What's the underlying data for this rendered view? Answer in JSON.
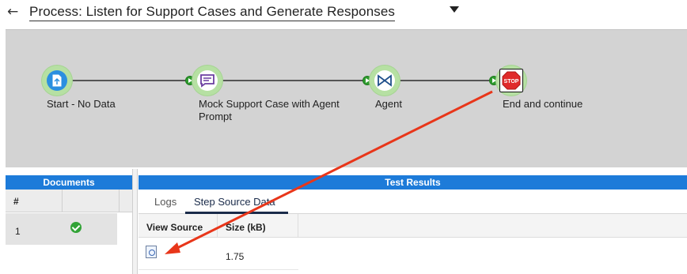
{
  "header": {
    "back_icon": "back-arrow-icon",
    "title": "Process: Listen for Support Cases and Generate Responses",
    "dropdown_icon": "caret-down-icon"
  },
  "flow": {
    "nodes": [
      {
        "label": "Start - No Data",
        "icon": "start-document-icon"
      },
      {
        "label": "Mock Support Case with Agent Prompt",
        "icon": "message-icon"
      },
      {
        "label": "Agent",
        "icon": "agent-icon"
      },
      {
        "label": "End and continue",
        "icon": "stop-sign-icon",
        "stop_text": "STOP"
      }
    ]
  },
  "documents": {
    "title": "Documents",
    "columns": [
      "#",
      ""
    ],
    "rows": [
      {
        "num": "1",
        "status": "success-check-icon"
      }
    ]
  },
  "test_results": {
    "title": "Test Results",
    "tabs": [
      "Logs",
      "Step Source Data"
    ],
    "active_tab": "Step Source Data",
    "table": {
      "columns": [
        "View Source",
        "Size (kB)"
      ],
      "rows": [
        {
          "view_source": "view-source-icon",
          "size": "1.75"
        }
      ]
    }
  },
  "colors": {
    "canvas_bg": "#d3d3d3",
    "node_ring": "#b6e0a3",
    "header_blue": "#1d7bd9",
    "annotation_arrow": "#e8361a"
  }
}
